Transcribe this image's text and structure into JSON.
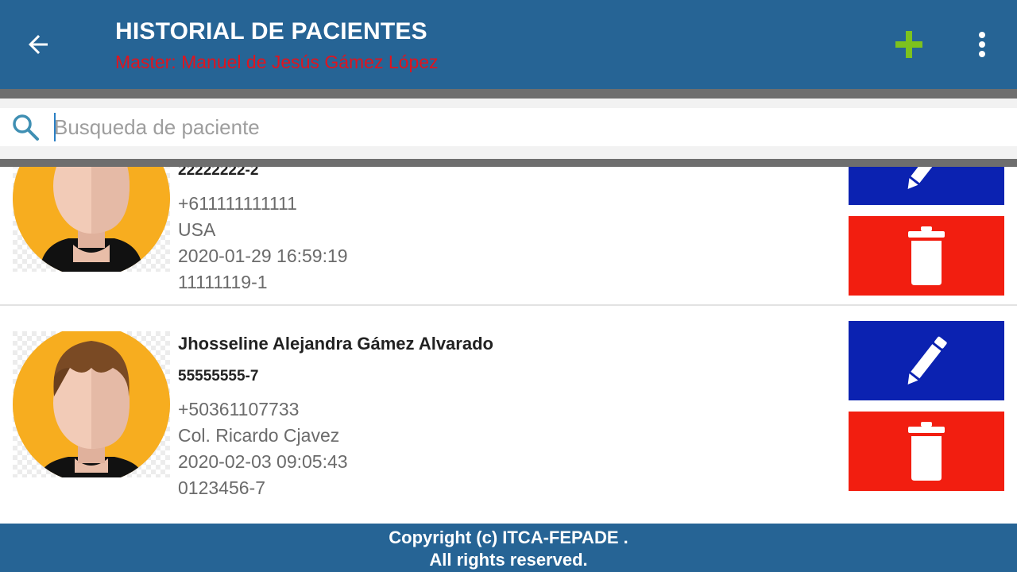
{
  "header": {
    "title": "HISTORIAL DE PACIENTES",
    "subtitle": "Master: Manuel de Jesús Gámez López",
    "back_icon": "arrow-back-icon",
    "add_icon": "plus-icon",
    "menu_icon": "more-vert-icon"
  },
  "search": {
    "placeholder": "Busqueda de paciente",
    "value": "",
    "icon": "search-icon"
  },
  "patients": [
    {
      "name": "",
      "id_number": "22222222-2",
      "phone": "+611111111111",
      "address": "USA",
      "date": "2020-01-29 16:59:19",
      "code": "11111119-1"
    },
    {
      "name": "Jhosseline Alejandra Gámez Alvarado",
      "id_number": "55555555-7",
      "phone": "+50361107733",
      "address": "Col. Ricardo Cjavez",
      "date": "2020-02-03 09:05:43",
      "code": "0123456-7"
    }
  ],
  "actions": {
    "edit_icon": "pencil-icon",
    "delete_icon": "trash-icon"
  },
  "footer": {
    "line1": "Copyright (c) ITCA-FEPADE .",
    "line2": "All rights reserved."
  },
  "colors": {
    "primary": "#266495",
    "subtitle": "#e0141e",
    "add_icon": "#7dc21e",
    "edit": "#0b22b1",
    "delete": "#f21e10",
    "avatar_bg": "#f7ad1f"
  }
}
